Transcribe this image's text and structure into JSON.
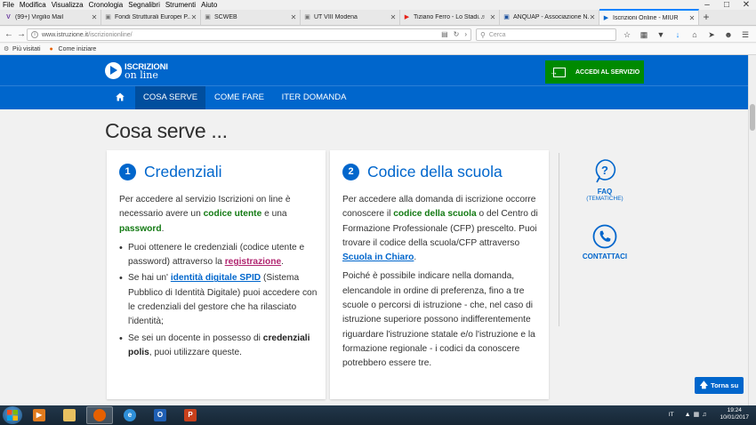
{
  "browser": {
    "menu": [
      "File",
      "Modifica",
      "Visualizza",
      "Cronologia",
      "Segnalibri",
      "Strumenti",
      "Aiuto"
    ],
    "tabs": [
      {
        "label": "(99+) Virgilio Mail",
        "icon": "V",
        "color": "#6a3aa0",
        "active": false
      },
      {
        "label": "Fondi Strutturali Europei P...",
        "icon": "▣",
        "color": "#777777",
        "active": false
      },
      {
        "label": "SCWEB",
        "icon": "▣",
        "color": "#777777",
        "active": false
      },
      {
        "label": "UT VIII Modena",
        "icon": "▣",
        "color": "#777777",
        "active": false
      },
      {
        "label": "Tiziano Ferro - Lo Stadi...",
        "icon": "▶",
        "color": "#e62117",
        "active": false,
        "audio": true
      },
      {
        "label": "ANQUAP - Associazione N...",
        "icon": "▣",
        "color": "#1a4f9c",
        "active": false
      },
      {
        "label": "Iscrizioni Online - MIUR",
        "icon": "▶",
        "color": "#0066cc",
        "active": true
      }
    ],
    "url_host": "www.istruzione.it",
    "url_path": "/iscrizionionline/",
    "search_placeholder": "Cerca",
    "bookmarks": [
      {
        "label": "Più visitati",
        "icon": "gear-icon"
      },
      {
        "label": "Come iniziare",
        "icon": "firefox-icon"
      }
    ]
  },
  "site": {
    "logo_line1": "ISCRIZIONI",
    "logo_line2": "on line",
    "access_button": "ACCEDI AL SERVIZIO",
    "nav": [
      {
        "label": "COSA SERVE",
        "active": true
      },
      {
        "label": "COME FARE",
        "active": false
      },
      {
        "label": "ITER DOMANDA",
        "active": false
      }
    ],
    "page_title": "Cosa serve ...",
    "card1": {
      "number": "1",
      "title": "Credenziali",
      "intro_a": "Per accedere al servizio Iscrizioni on line è necessario avere un ",
      "intro_b": "codice utente",
      "intro_c": " e una ",
      "intro_d": "password",
      "intro_e": ".",
      "b1_a": "Puoi ottenere le credenziali (codice utente e password) attraverso la ",
      "b1_link": "registrazione",
      "b1_b": ".",
      "b2_a": "Se hai un' ",
      "b2_link": "identità digitale SPID",
      "b2_b": " (Sistema Pubblico di Identità Digitale) puoi accedere con le credenziali del gestore che ha rilasciato l'identità;",
      "b3_a": "Se sei un docente in possesso di ",
      "b3_bold": "credenziali polis",
      "b3_b": ", puoi utilizzare queste."
    },
    "card2": {
      "number": "2",
      "title": "Codice della scuola",
      "p1_a": "Per accedere alla domanda di iscrizione occorre conoscere il ",
      "p1_bold": "codice della scuola",
      "p1_b": " o del Centro di Formazione Professionale (CFP) prescelto. Puoi trovare il codice della scuola/CFP attraverso ",
      "p1_link": "Scuola in Chiaro",
      "p1_c": ".",
      "p2": "Poiché è possibile indicare nella domanda, elencandole in ordine di preferenza, fino a tre scuole o percorsi di istruzione - che, nel caso di istruzione superiore possono indifferentemente riguardare l'istruzione statale e/o l'istruzione e la formazione regionale - i codici da conoscere potrebbero essere tre."
    },
    "faq_label": "FAQ",
    "faq_sub": "(TEMATICHE)",
    "contact_label": "CONTATTACI",
    "back_to_top": "Torna su"
  },
  "taskbar": {
    "language": "IT",
    "time": "19:24",
    "date": "10/01/2017"
  }
}
